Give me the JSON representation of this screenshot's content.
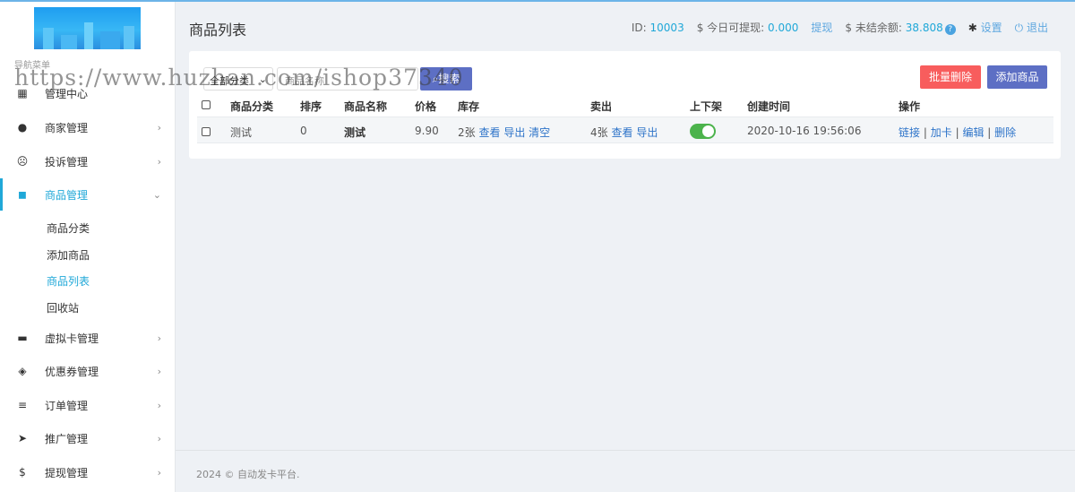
{
  "header": {
    "title": "商品列表",
    "id_label": "ID:",
    "id_value": "10003",
    "withdrawable_label": "$ 今日可提现:",
    "withdrawable_value": "0.000",
    "withdraw_link": "提现",
    "unsettled_label": "$ 未结余额:",
    "unsettled_value": "38.808",
    "settings": "设置",
    "logout": "退出"
  },
  "sidebar": {
    "caption": "导航菜单",
    "items": [
      {
        "label": "管理中心",
        "icon": "dashboard-icon"
      },
      {
        "label": "商家管理",
        "icon": "user-icon"
      },
      {
        "label": "投诉管理",
        "icon": "frown-icon"
      },
      {
        "label": "商品管理",
        "icon": "bag-icon"
      },
      {
        "label": "虚拟卡管理",
        "icon": "card-icon"
      },
      {
        "label": "优惠券管理",
        "icon": "ticket-icon"
      },
      {
        "label": "订单管理",
        "icon": "list-icon"
      },
      {
        "label": "推广管理",
        "icon": "send-icon"
      },
      {
        "label": "提现管理",
        "icon": "dollar-icon"
      }
    ],
    "subitems": [
      "商品分类",
      "添加商品",
      "商品列表",
      "回收站"
    ]
  },
  "filters": {
    "category_select": "全部分类",
    "name_placeholder": "商品名称",
    "search_button": "搜索",
    "batch_delete": "批量删除",
    "add_product": "添加商品"
  },
  "table": {
    "headers": [
      "商品分类",
      "排序",
      "商品名称",
      "价格",
      "库存",
      "卖出",
      "上下架",
      "创建时间",
      "操作"
    ],
    "rows": [
      {
        "category": "测试",
        "sort": "0",
        "name": "测试",
        "price": "9.90",
        "stock": "2张",
        "stock_view": "查看",
        "stock_export": "导出",
        "stock_clear": "清空",
        "sold": "4张",
        "sold_view": "查看",
        "sold_export": "导出",
        "on_shelf": true,
        "created": "2020-10-16 19:56:06",
        "act_link": "链接",
        "act_addcard": "加卡",
        "act_edit": "编辑",
        "act_delete": "删除",
        "sep": "|"
      }
    ]
  },
  "footer": {
    "text": "2024 © 自动发卡平台."
  },
  "watermark": "https://www.huzhan.com/ishop37340"
}
